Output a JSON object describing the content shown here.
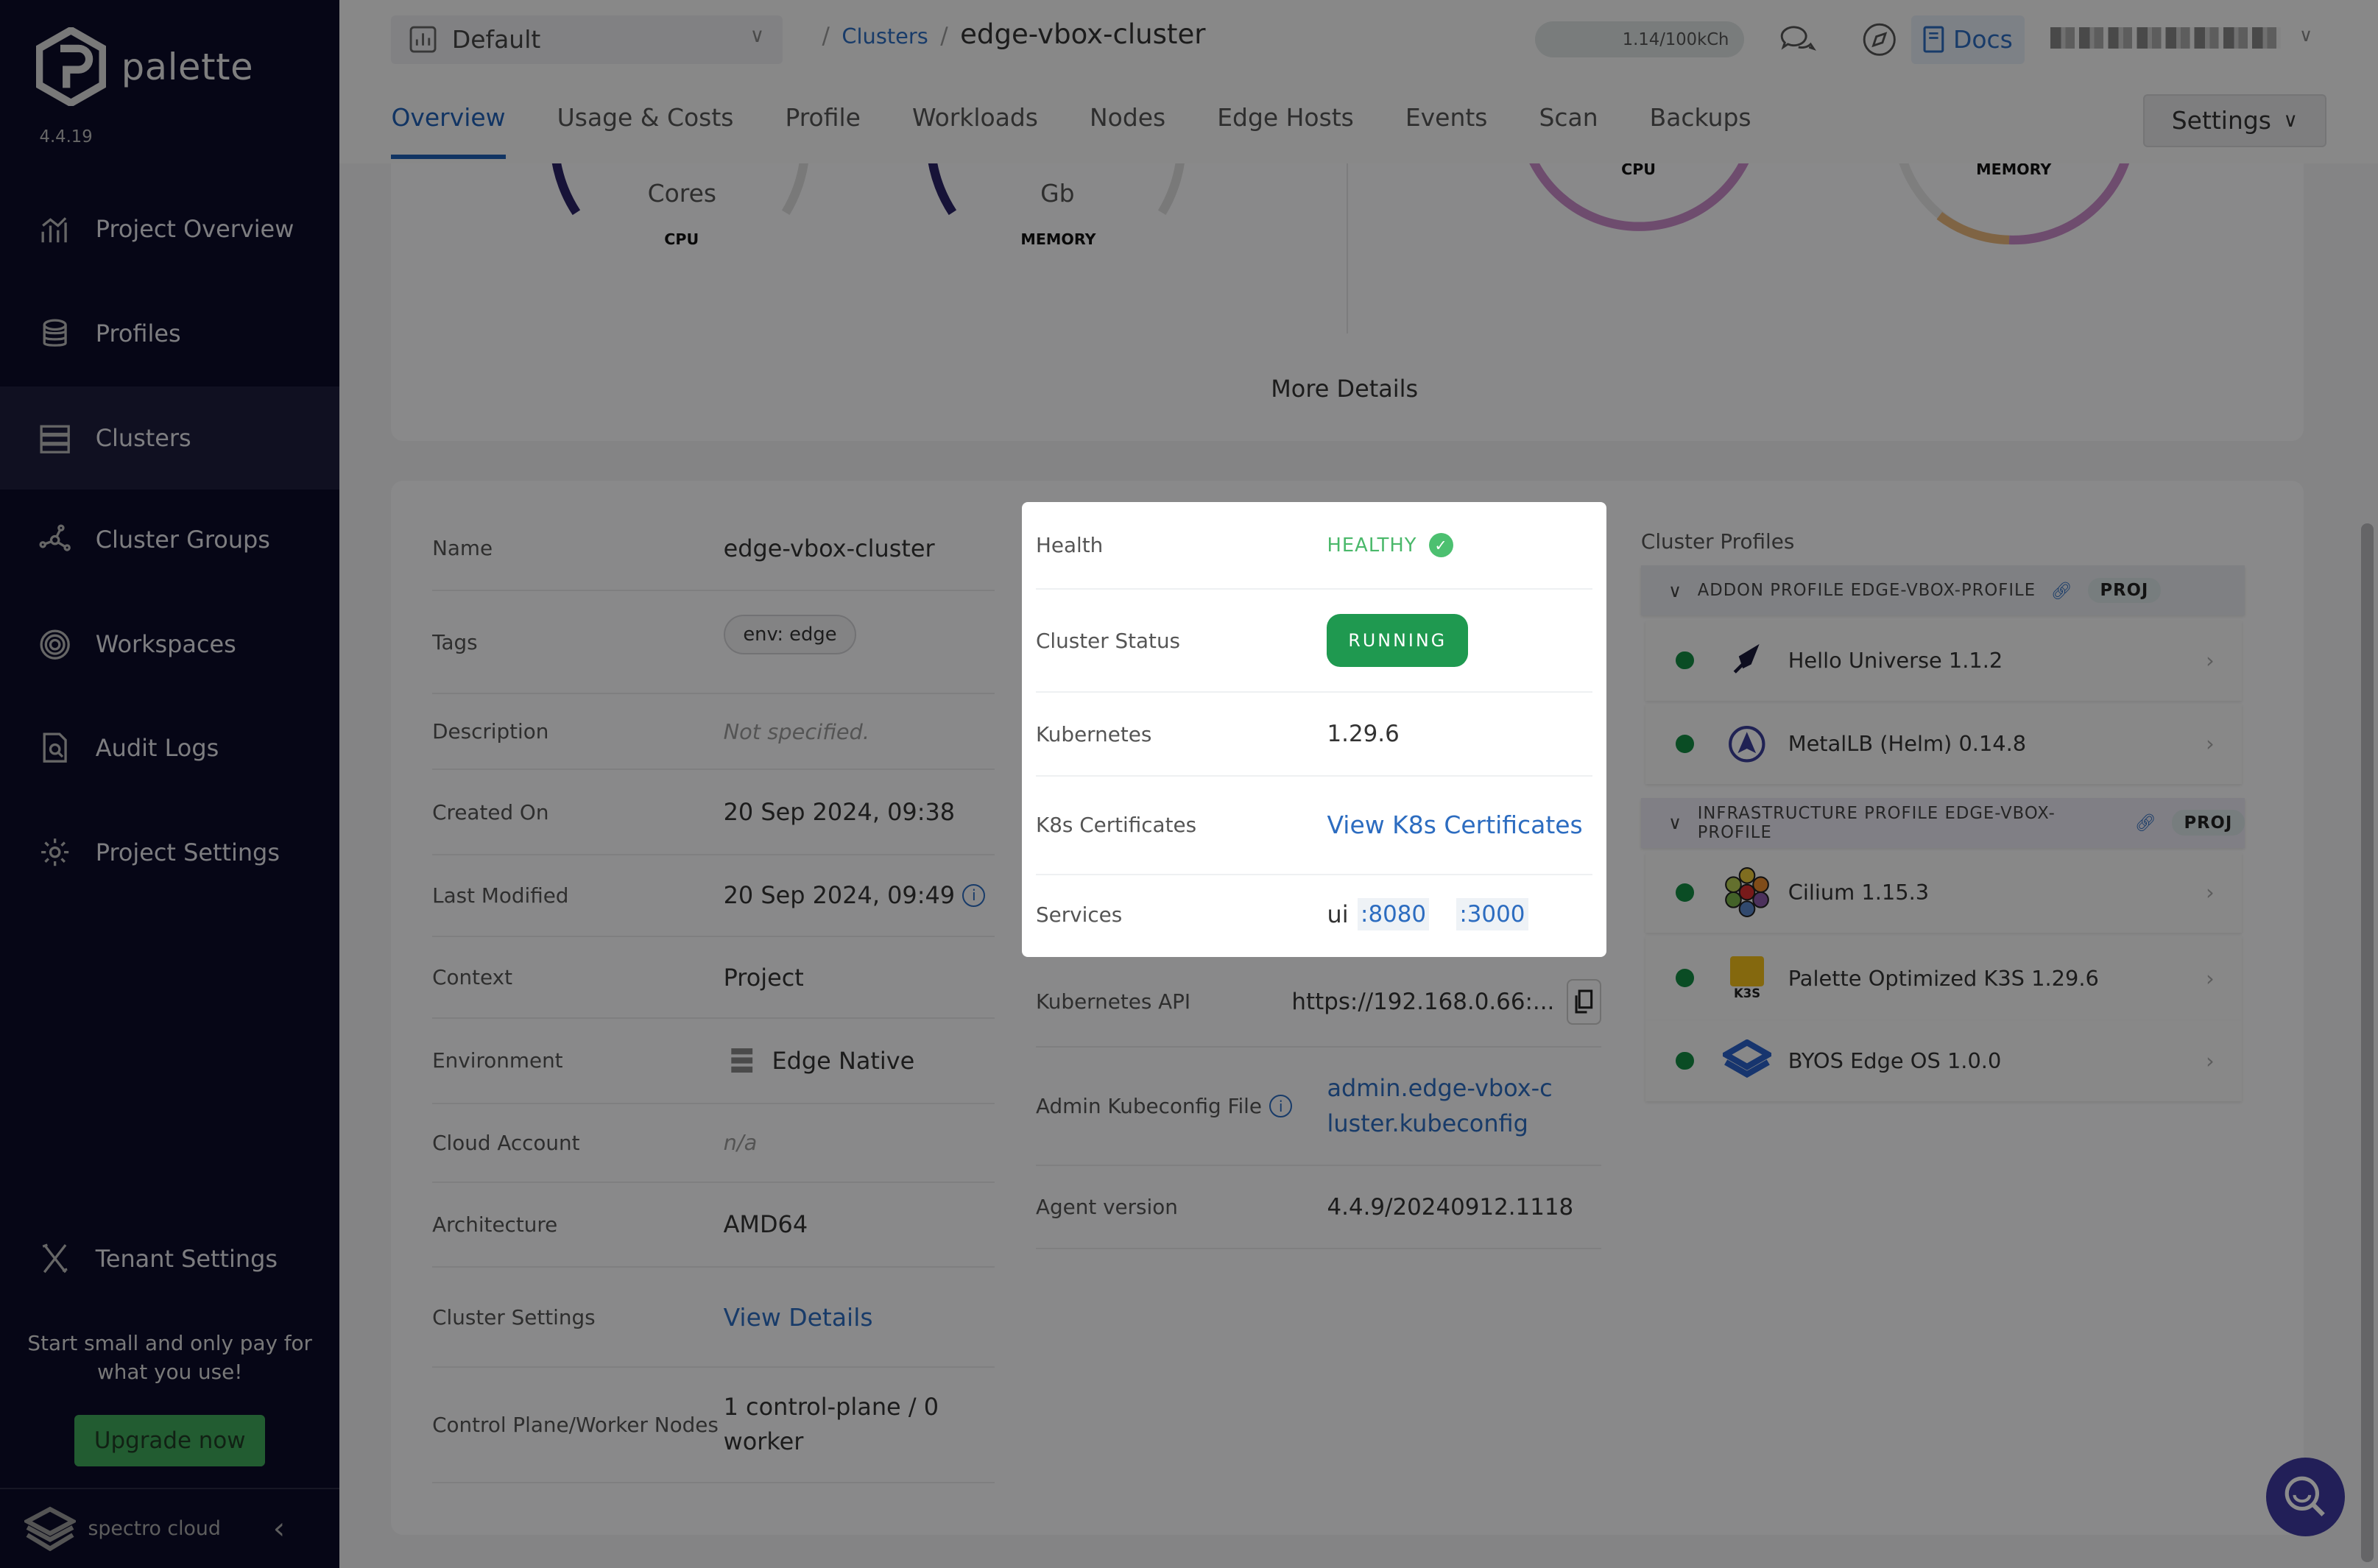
{
  "app": {
    "name": "palette",
    "version": "4.4.19"
  },
  "sidebar": {
    "items": [
      {
        "label": "Project Overview",
        "icon": "chart-icon"
      },
      {
        "label": "Profiles",
        "icon": "stack-icon"
      },
      {
        "label": "Clusters",
        "icon": "server-icon",
        "active": true
      },
      {
        "label": "Cluster Groups",
        "icon": "network-icon"
      },
      {
        "label": "Workspaces",
        "icon": "target-icon"
      },
      {
        "label": "Audit Logs",
        "icon": "file-search-icon"
      },
      {
        "label": "Project Settings",
        "icon": "gear-icon"
      }
    ],
    "tenant_settings": "Tenant Settings",
    "promo": "Start small and only pay for what you use!",
    "upgrade": "Upgrade now",
    "footer_brand": "spectro cloud"
  },
  "header": {
    "project": "Default",
    "breadcrumb": {
      "parent": "Clusters",
      "current": "edge-vbox-cluster"
    },
    "usage": "1.14/100kCh",
    "docs": "Docs"
  },
  "tabs": [
    "Overview",
    "Usage & Costs",
    "Profile",
    "Workloads",
    "Nodes",
    "Edge Hosts",
    "Events",
    "Scan",
    "Backups"
  ],
  "settings_button": "Settings",
  "summary": {
    "cpu_unit": "Cores",
    "cpu_label": "CPU",
    "memory_unit": "Gb",
    "memory_label": "MEMORY",
    "more_details": "More Details"
  },
  "details": {
    "name": {
      "label": "Name",
      "value": "edge-vbox-cluster"
    },
    "tags": {
      "label": "Tags",
      "value": "env: edge"
    },
    "description": {
      "label": "Description",
      "value": "Not specified."
    },
    "created": {
      "label": "Created On",
      "value": "20 Sep 2024, 09:38"
    },
    "modified": {
      "label": "Last Modified",
      "value": "20 Sep 2024, 09:49"
    },
    "context": {
      "label": "Context",
      "value": "Project"
    },
    "environment": {
      "label": "Environment",
      "value": "Edge Native"
    },
    "cloud_account": {
      "label": "Cloud Account",
      "value": "n/a"
    },
    "architecture": {
      "label": "Architecture",
      "value": "AMD64"
    },
    "cluster_settings": {
      "label": "Cluster Settings",
      "value": "View Details"
    },
    "nodes": {
      "label": "Control Plane/Worker Nodes",
      "value": "1 control-plane / 0 worker"
    }
  },
  "status": {
    "health": {
      "label": "Health",
      "value": "HEALTHY"
    },
    "cluster_status": {
      "label": "Cluster Status",
      "value": "RUNNING"
    },
    "kubernetes": {
      "label": "Kubernetes",
      "value": "1.29.6"
    },
    "certs": {
      "label": "K8s Certificates",
      "value": "View K8s Certificates"
    },
    "services": {
      "label": "Services",
      "name": "ui",
      "ports": [
        ":8080",
        ":3000"
      ]
    },
    "api": {
      "label": "Kubernetes API",
      "value": "https://192.168.0.66:..."
    },
    "kubeconfig": {
      "label": "Admin Kubeconfig File",
      "value": "admin.edge-vbox-cluster.kubeconfig"
    },
    "agent": {
      "label": "Agent version",
      "value": "4.4.9/20240912.1118"
    }
  },
  "cluster_profiles": {
    "title": "Cluster Profiles",
    "groups": [
      {
        "title": "ADDON PROFILE EDGE-VBOX-PROFILE",
        "badge": "PROJ",
        "packs": [
          {
            "name": "Hello Universe 1.1.2",
            "icon": "rocket-icon"
          },
          {
            "name": "MetalLB (Helm) 0.14.8",
            "icon": "metallb-icon"
          }
        ]
      },
      {
        "title": "INFRASTRUCTURE PROFILE EDGE-VBOX-PROFILE",
        "badge": "PROJ",
        "packs": [
          {
            "name": "Cilium 1.15.3",
            "icon": "cilium-icon"
          },
          {
            "name": "Palette Optimized K3S 1.29.6",
            "icon": "k3s-icon",
            "icon_text": "K3S"
          },
          {
            "name": "BYOS Edge OS 1.0.0",
            "icon": "byos-icon"
          }
        ]
      }
    ]
  },
  "colors": {
    "accent": "#2c6cc0",
    "healthy": "#4ab86a",
    "running": "#1f9950",
    "sidebar": "#0b0b28"
  }
}
